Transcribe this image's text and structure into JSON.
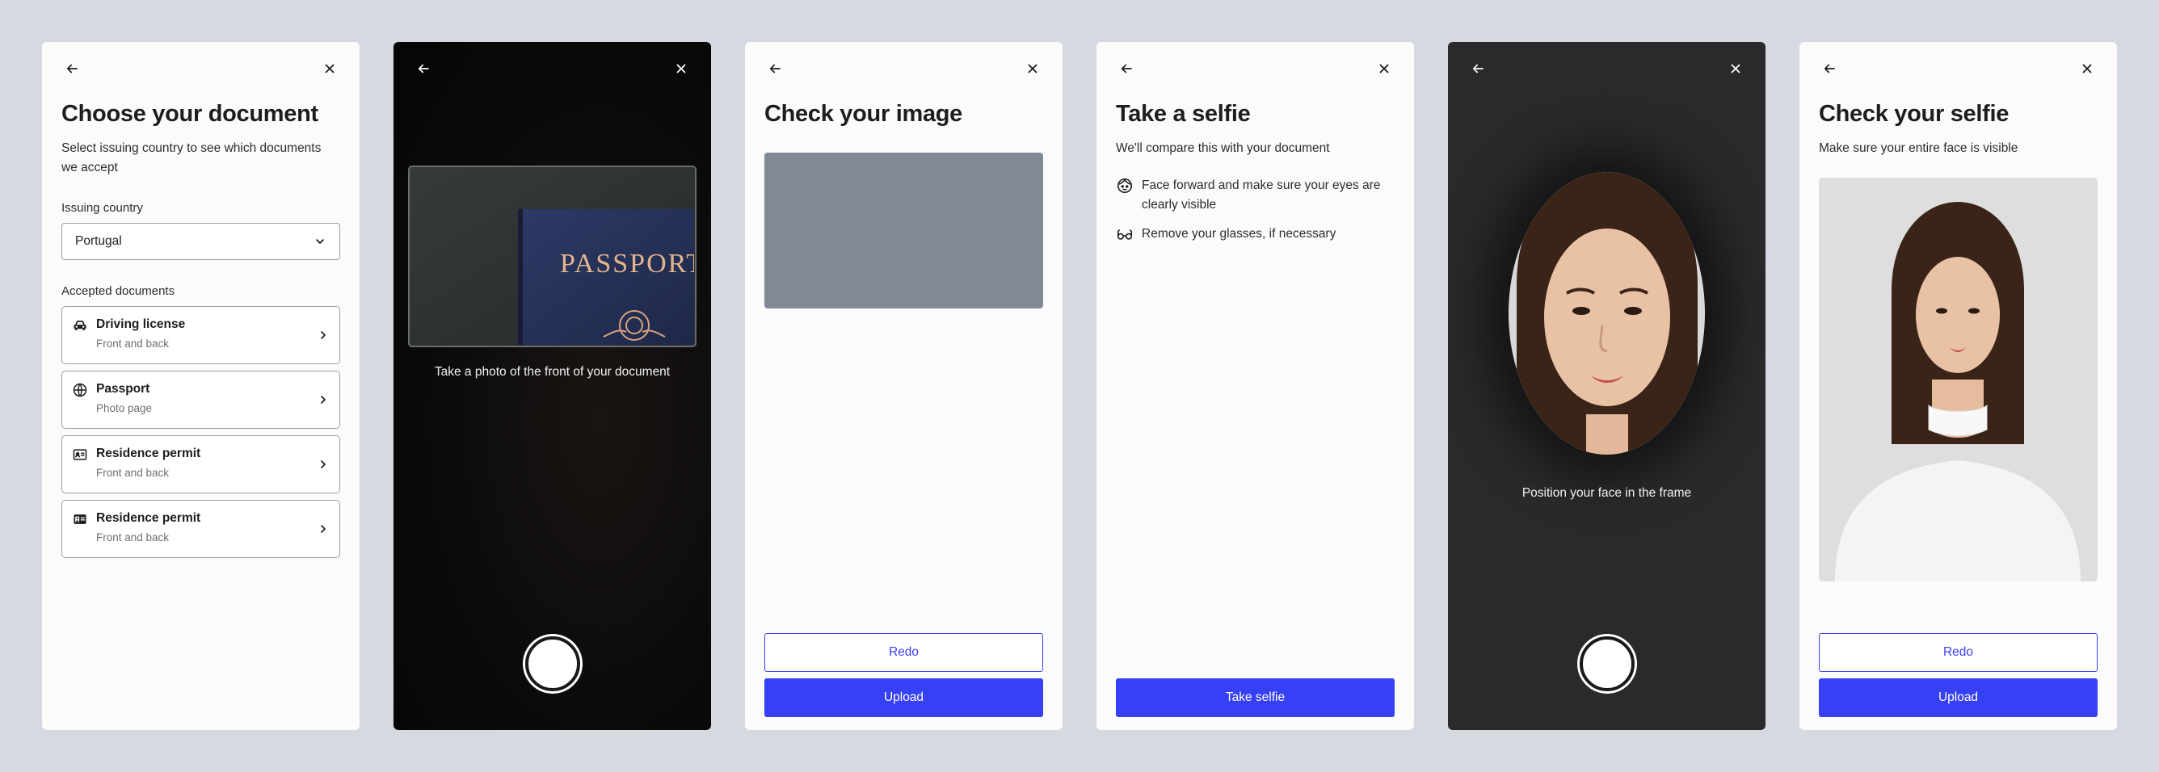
{
  "screens": {
    "choose_document": {
      "title": "Choose your document",
      "subtitle": "Select issuing country to see which documents we accept",
      "country_label": "Issuing country",
      "country_value": "Portugal",
      "accepted_label": "Accepted documents",
      "documents": [
        {
          "name": "Driving license",
          "sub": "Front and back",
          "icon": "car-icon"
        },
        {
          "name": "Passport",
          "sub": "Photo page",
          "icon": "globe-icon"
        },
        {
          "name": "Residence permit",
          "sub": "Front and back",
          "icon": "id-card-icon"
        },
        {
          "name": "Residence permit",
          "sub": "Front and back",
          "icon": "photo-id-icon"
        }
      ]
    },
    "camera_document": {
      "viewfinder_text": "PASSPORT",
      "caption": "Take a photo of the front of your document"
    },
    "check_image": {
      "title": "Check your image",
      "redo_label": "Redo",
      "upload_label": "Upload"
    },
    "take_selfie": {
      "title": "Take a selfie",
      "subtitle": "We'll compare this with your document",
      "tips": [
        {
          "text": "Face forward and make sure your eyes are clearly visible",
          "icon": "face-icon"
        },
        {
          "text": "Remove your glasses, if necessary",
          "icon": "glasses-icon"
        }
      ],
      "button_label": "Take selfie"
    },
    "camera_selfie": {
      "caption": "Position your face in the frame"
    },
    "check_selfie": {
      "title": "Check your selfie",
      "subtitle": "Make sure your entire face is visible",
      "redo_label": "Redo",
      "upload_label": "Upload"
    }
  },
  "colors": {
    "background": "#d5d9e0",
    "primary": "#3640f5",
    "card": "#fbfbfc",
    "camera_dark": "#0b0b0c"
  }
}
